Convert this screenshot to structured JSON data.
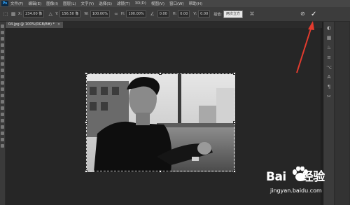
{
  "menubar": {
    "logo": "Ps",
    "items": [
      "文件(F)",
      "编辑(E)",
      "图像(I)",
      "图层(L)",
      "文字(Y)",
      "选择(S)",
      "滤镜(T)",
      "3D(D)",
      "视图(V)",
      "窗口(W)",
      "帮助(H)"
    ]
  },
  "options": {
    "x_label": "X:",
    "x_value": "234.00 像",
    "y_label": "Y:",
    "y_value": "156.50 像",
    "w_label": "W:",
    "w_value": "100.00%",
    "h_label": "H:",
    "h_value": "100.00%",
    "angle_value": "0.00",
    "hskew_label": "H:",
    "hskew_value": "0.00",
    "vskew_label": "V:",
    "vskew_value": "0.00",
    "interp_label": "插值:",
    "interp_value": "两次立方"
  },
  "document": {
    "tab_label": "04.jpg @ 100%(RGB/8#) *",
    "tab_close": "×"
  },
  "watermark": {
    "brand_left": "Bai",
    "brand_right": "经验",
    "url": "jingyan.baidu.com"
  },
  "icons": {
    "commit": "check-icon",
    "cancel": "cancel-icon"
  }
}
